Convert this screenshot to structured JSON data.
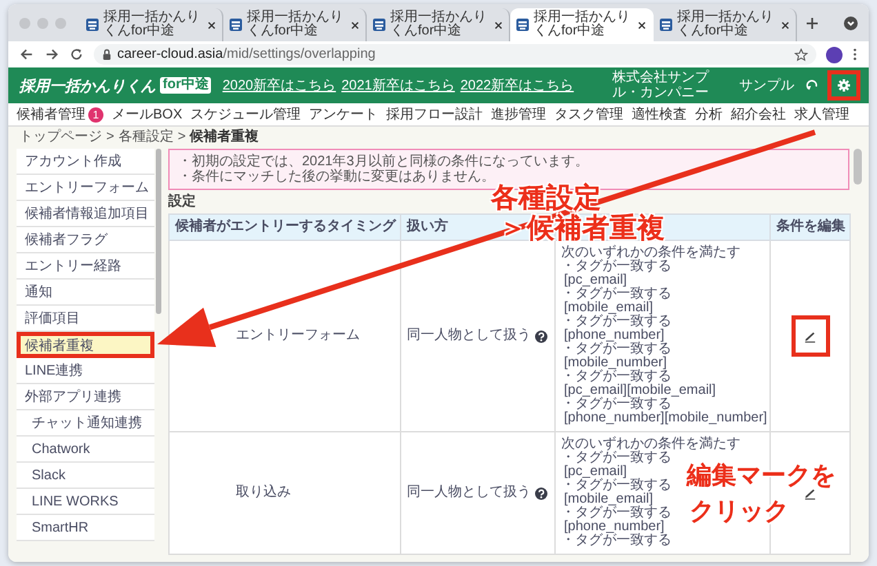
{
  "browser": {
    "tabs": [
      {
        "title": "採用一括かんりくんfor中途",
        "selected": false
      },
      {
        "title": "採用一括かんりくんfor中途",
        "selected": false
      },
      {
        "title": "採用一括かんりくんfor中途",
        "selected": false
      },
      {
        "title": "採用一括かんりくんfor中途",
        "selected": true
      },
      {
        "title": "採用一括かんりくんfor中途",
        "selected": false
      }
    ],
    "url_host": "career-cloud.asia",
    "url_path": "/mid/settings/overlapping"
  },
  "header": {
    "logo": "採用一括かんりくん",
    "logo_badge": "for中途",
    "links": [
      "2020新卒はこちら",
      "2021新卒はこちら",
      "2022新卒はこちら"
    ],
    "company": "株式会社サンプル・カンパニー",
    "user": "サンプル",
    "settings_highlighted": true
  },
  "nav": [
    {
      "label": "候補者管理",
      "badge": "1"
    },
    {
      "label": "メールBOX"
    },
    {
      "label": "スケジュール管理"
    },
    {
      "label": "アンケート"
    },
    {
      "label": "採用フロー設計"
    },
    {
      "label": "進捗管理"
    },
    {
      "label": "タスク管理"
    },
    {
      "label": "適性検査"
    },
    {
      "label": "分析"
    },
    {
      "label": "紹介会社"
    },
    {
      "label": "求人管理"
    }
  ],
  "breadcrumb": {
    "separator": ">",
    "items": [
      {
        "label": "トップページ",
        "current": false
      },
      {
        "label": "各種設定",
        "current": false
      },
      {
        "label": "候補者重複",
        "current": true
      }
    ]
  },
  "sidebar": {
    "items": [
      {
        "label": "アカウント作成",
        "selected": false,
        "highlighted": false
      },
      {
        "label": "エントリーフォーム",
        "selected": false,
        "highlighted": false
      },
      {
        "label": "候補者情報追加項目",
        "selected": false,
        "highlighted": false
      },
      {
        "label": "候補者フラグ",
        "selected": false,
        "highlighted": false
      },
      {
        "label": "エントリー経路",
        "selected": false,
        "highlighted": false
      },
      {
        "label": "通知",
        "selected": false,
        "highlighted": false
      },
      {
        "label": "評価項目",
        "selected": false,
        "highlighted": false
      },
      {
        "label": "候補者重複",
        "selected": true,
        "highlighted": true
      },
      {
        "label": "LINE連携",
        "selected": false,
        "highlighted": false
      },
      {
        "label": "外部アプリ連携",
        "selected": false,
        "highlighted": false,
        "children": [
          {
            "label": "チャット通知連携",
            "selected": false
          },
          {
            "label": "Chatwork",
            "selected": false
          },
          {
            "label": "Slack",
            "selected": false
          },
          {
            "label": "LINE WORKS",
            "selected": false
          },
          {
            "label": "SmartHR",
            "selected": false
          }
        ]
      }
    ]
  },
  "notice": [
    "・初期の設定では、2021年3月以前と同様の条件になっています。",
    "・条件にマッチした後の挙動に変更はありません。"
  ],
  "section_title": "設定",
  "table": {
    "columns": {
      "timing": "候補者がエントリーするタイミング",
      "handling": "扱い方",
      "edit": "条件を編集"
    },
    "rows": [
      {
        "timing": "エントリーフォーム",
        "handling": "同一人物として扱う",
        "conditions_title": "次のいずれかの条件を満たす",
        "highlighted": true,
        "conditions": [
          {
            "rule": "・タグが一致する",
            "tags": "[pc_email]"
          },
          {
            "rule": "・タグが一致する",
            "tags": "[mobile_email]"
          },
          {
            "rule": "・タグが一致する",
            "tags": "[phone_number]"
          },
          {
            "rule": "・タグが一致する",
            "tags": "[mobile_number]"
          },
          {
            "rule": "・タグが一致する",
            "tags": "[pc_email][mobile_email]"
          },
          {
            "rule": "・タグが一致する",
            "tags": "[phone_number][mobile_number]"
          }
        ]
      },
      {
        "timing": "取り込み",
        "handling": "同一人物として扱う",
        "conditions_title": "次のいずれかの条件を満たす",
        "highlighted": false,
        "conditions": [
          {
            "rule": "・タグが一致する",
            "tags": "[pc_email]"
          },
          {
            "rule": "・タグが一致する",
            "tags": "[mobile_email]"
          },
          {
            "rule": "・タグが一致する",
            "tags": "[phone_number]"
          },
          {
            "rule": "・タグが一致する"
          }
        ]
      }
    ]
  },
  "annotations": [
    {
      "text": "各種設定"
    },
    {
      "text": "＞候補者重複"
    },
    {
      "text": "編集マークを"
    },
    {
      "text": "クリック"
    }
  ]
}
